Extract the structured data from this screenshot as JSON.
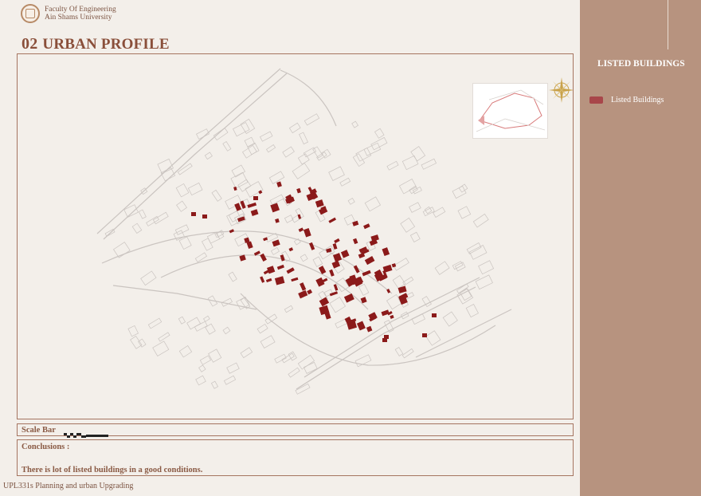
{
  "header": {
    "faculty_line1": "Faculty Of Engineering",
    "faculty_line2": "Ain Shams University"
  },
  "title": {
    "number": "02",
    "text": "URBAN PROFILE"
  },
  "map": {
    "highlight_color": "#8b1a1a",
    "context_color": "#c9c3bf"
  },
  "scale": {
    "label": "Scale Bar"
  },
  "conclusions": {
    "title": "Conclusions :",
    "text": "There is lot of listed buildings in a good conditions."
  },
  "footer": {
    "course": "UPL331s Planning and urban Upgrading"
  },
  "sidebar": {
    "title": "LISTED BUILDINGS",
    "legend": [
      {
        "label": "Listed Buildings",
        "color": "#a8464a"
      }
    ]
  },
  "colors": {
    "accent": "#8a4f3a",
    "sidebar": "#b7937f",
    "background": "#f3efea"
  }
}
